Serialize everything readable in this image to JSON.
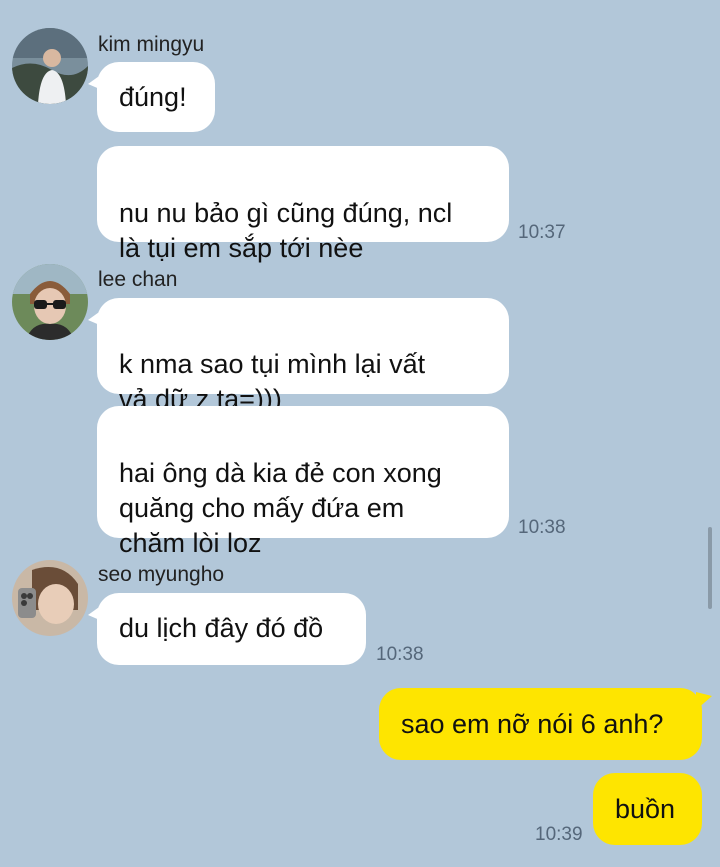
{
  "messages": [
    {
      "sender": "kim mingyu",
      "avatar_icon": "profile-photo-man-outdoors-icon",
      "bubbles": [
        "đúng!",
        "nu nu bảo gì cũng đúng, ncl\nlà tụi em sắp tới nèe"
      ],
      "time": "10:37"
    },
    {
      "sender": "lee chan",
      "avatar_icon": "profile-photo-sunglasses-icon",
      "bubbles": [
        "k nma sao tụi mình lại vất\nvả dữ z ta=)))",
        "hai ông dà kia đẻ con xong\nquăng cho mấy đứa em\nchăm lòi loz"
      ],
      "time": "10:38"
    },
    {
      "sender": "seo myungho",
      "avatar_icon": "profile-photo-mirror-selfie-icon",
      "bubbles": [
        "du lịch đây đó đồ"
      ],
      "time": "10:38"
    },
    {
      "sender": "me",
      "bubbles": [
        "sao em nỡ nói 6 anh?",
        "buồn"
      ],
      "time": "10:39"
    }
  ],
  "colors": {
    "background": "#b2c7d9",
    "incoming_bubble": "#ffffff",
    "outgoing_bubble": "#fee500"
  }
}
